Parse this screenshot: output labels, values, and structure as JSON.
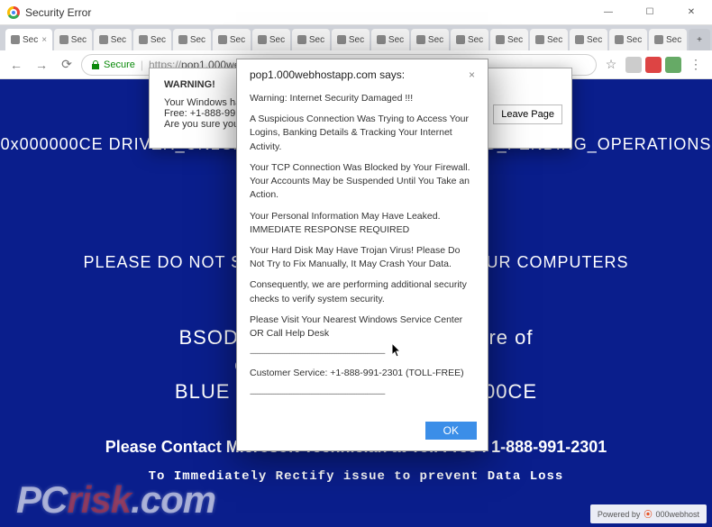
{
  "window": {
    "title": "Security Error",
    "minimize": "—",
    "maximize": "☐",
    "close": "✕"
  },
  "tabs": {
    "active_label": "Sec",
    "others_label": "Sec",
    "new_label": "+",
    "tab_close": "×",
    "count_others": 16
  },
  "nav": {
    "back": "←",
    "forward": "→",
    "reload": "⟳",
    "secure_label": "Secure",
    "url_scheme": "https://",
    "url_host": "pop1.000webhostapp.com",
    "star": "☆",
    "menu": "⋮"
  },
  "bsod": {
    "line1": "0x000000CE DRIVER_UNLOADED_WITHOUT_CANCELLING_PENDING_OPERATIONS",
    "line2": "PLEASE DO NOT SHUT DOWN OR RESTART YOUR COMPUTERS",
    "err1": "BSOD : Error 333 Registry Failure of",
    "err2": "operating system - Host :",
    "err3": "BLUE SCREEN ERROR 0x000000CE",
    "contact": "Please Contact Microsoft Technician at Toll Free : 1-888-991-2301",
    "rectify": "To Immediately Rectify issue to prevent Data Loss"
  },
  "dlg_behind": {
    "title": "WARNING!",
    "line1": "Your Windows has been blocked due to suspicious activity! Please call-",
    "line2": "Free: +1-888-991-2301",
    "line3": "Are you sure you want to leave this page?",
    "button": "Leave Page"
  },
  "dialog": {
    "origin": "pop1.000webhostapp.com says:",
    "close_x": "×",
    "p1": "Warning: Internet Security Damaged !!!",
    "p2": "A Suspicious Connection Was Trying to Access Your Logins, Banking Details & Tracking Your Internet Activity.",
    "p3": "Your TCP Connection Was Blocked by Your Firewall. Your Accounts May be Suspended Until You Take an Action.",
    "p4": "Your Personal Information May Have Leaked. IMMEDIATE RESPONSE REQUIRED",
    "p5": "Your Hard Disk May Have Trojan Virus! Please Do Not Try to Fix Manually, It May Crash Your Data.",
    "p6": "Consequently, we are performing additional security checks to verify system security.",
    "p7": "Please Visit Your Nearest Windows Service Center OR Call Help Desk",
    "sep": "---------------------------------------------------------------------------",
    "p8": "Customer Service: +1-888-991-2301  (TOLL-FREE)",
    "ok": "OK"
  },
  "watermark": {
    "pc": "PC",
    "risk": "risk",
    "com": ".com"
  },
  "powered": {
    "label": "Powered by",
    "brand": "000webhost",
    "glyph": "⦿"
  }
}
